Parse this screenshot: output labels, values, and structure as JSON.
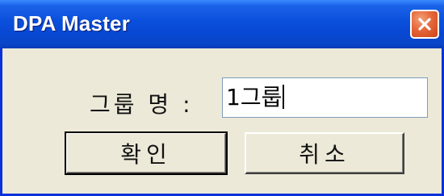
{
  "window": {
    "title": "DPA Master",
    "close_icon": "close-icon"
  },
  "form": {
    "group_name_label": "그룹 명 :",
    "group_name_value": "1그룹"
  },
  "buttons": {
    "ok_label": "확인",
    "cancel_label": "취소"
  },
  "colors": {
    "titlebar": "#0a4fdc",
    "close_button": "#e5673a",
    "dialog_background": "#ece9d8"
  }
}
